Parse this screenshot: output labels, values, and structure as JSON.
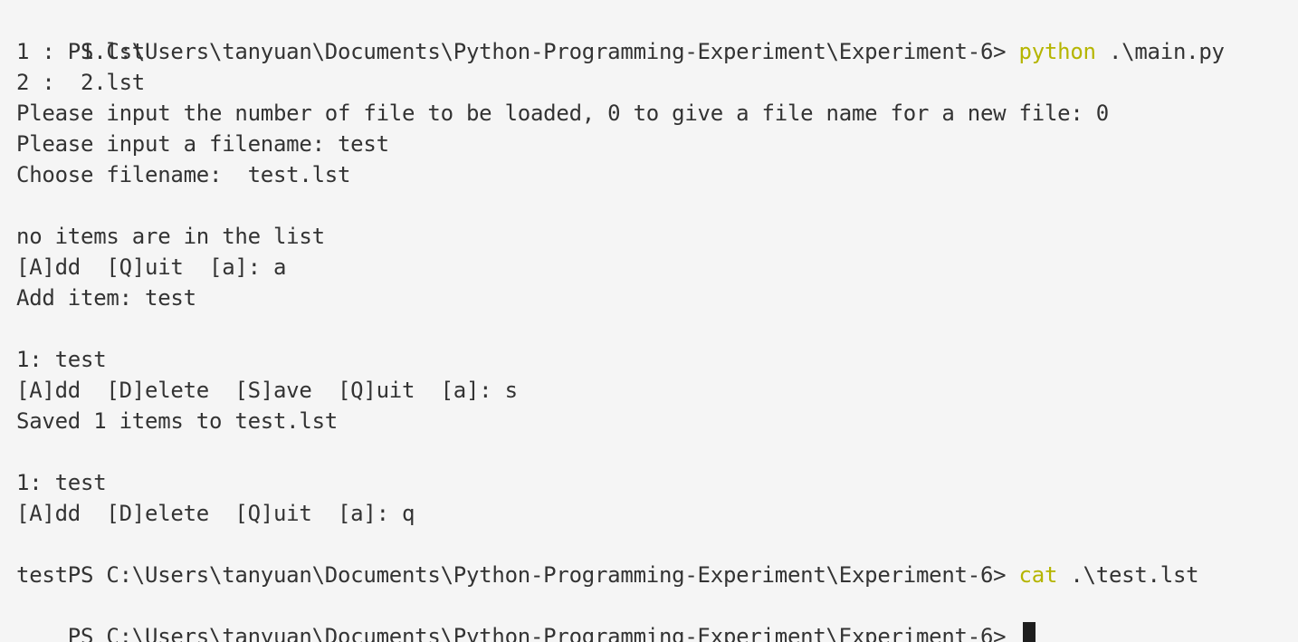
{
  "terminal": {
    "colors": {
      "background": "#f5f5f5",
      "text": "#333333",
      "command": "#b5b500",
      "cursor": "#1e1e1e"
    },
    "prompt": "PS C:\\Users\\tanyuan\\Documents\\Python-Programming-Experiment\\Experiment-6> ",
    "lines": {
      "l1": {
        "cmd": "python",
        "arg": " .\\main.py"
      },
      "l2": "1 :  1.lst",
      "l3": "2 :  2.lst",
      "l4": "Please input the number of file to be loaded, 0 to give a file name for a new file: 0",
      "l5": "Please input a filename: test",
      "l6": "Choose filename:  test.lst",
      "l7": "",
      "l8": "no items are in the list",
      "l9": "[A]dd  [Q]uit  [a]: a",
      "l10": "Add item: test",
      "l11": "",
      "l12": "1: test",
      "l13": "[A]dd  [D]elete  [S]ave  [Q]uit  [a]: s",
      "l14": "Saved 1 items to test.lst",
      "l15": "",
      "l16": "1: test",
      "l17": "[A]dd  [D]elete  [Q]uit  [a]: q",
      "l18": {
        "cmd": "cat",
        "arg": " .\\test.lst"
      },
      "l19": "test"
    }
  }
}
